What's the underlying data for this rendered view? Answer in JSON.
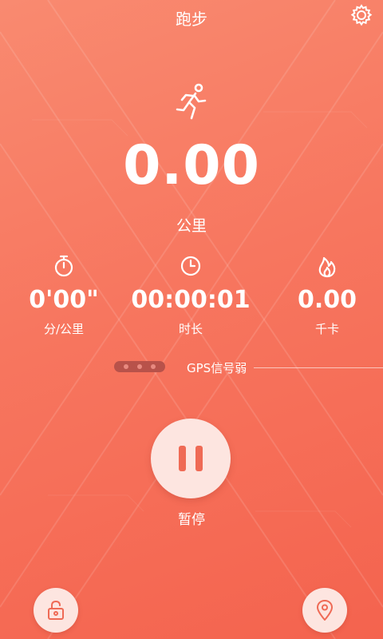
{
  "header": {
    "title": "跑步"
  },
  "main": {
    "distance": "0.00",
    "distance_unit": "公里"
  },
  "stats": [
    {
      "value": "0'00\"",
      "label": "分/公里",
      "icon": "stopwatch-icon"
    },
    {
      "value": "00:00:01",
      "label": "时长",
      "icon": "clock-icon"
    },
    {
      "value": "0.00",
      "label": "千卡",
      "icon": "flame-icon"
    }
  ],
  "gps": {
    "status": "GPS信号弱"
  },
  "controls": {
    "pause_label": "暂停"
  },
  "colors": {
    "accent": "#ef6a55",
    "background": "#f7765f",
    "button_bg": "#fde5e0"
  }
}
